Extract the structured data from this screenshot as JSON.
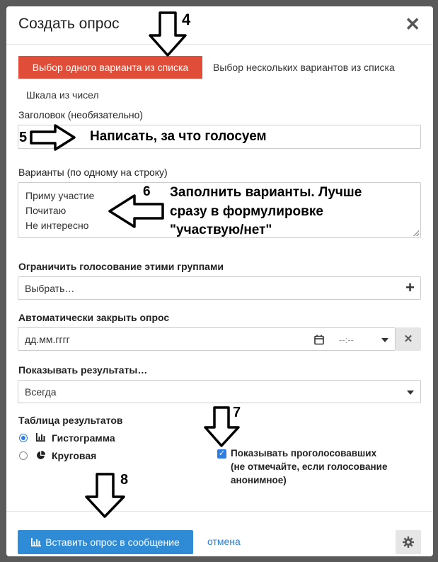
{
  "dialog": {
    "title": "Создать опрос",
    "close_label": "✕"
  },
  "tabs": [
    {
      "label": "Выбор одного варианта из списка",
      "active": true
    },
    {
      "label": "Выбор нескольких вариантов из списка",
      "active": false
    },
    {
      "label": "Шкала из чисел",
      "active": false
    }
  ],
  "question": {
    "label": "Заголовок (необязательно)",
    "value": ""
  },
  "options": {
    "label": "Варианты (по одному на строку)",
    "lines": [
      "Приму участие",
      "Почитаю",
      "Не интересно"
    ]
  },
  "groups": {
    "label": "Ограничить голосование этими группами",
    "placeholder": "Выбрать…",
    "add_label": "+"
  },
  "autoclose": {
    "label": "Автоматически закрыть опрос",
    "date_placeholder": "дд.мм.гггг",
    "time_placeholder": "--:--",
    "clear_label": "✕"
  },
  "results": {
    "label": "Показывать результаты…",
    "selected": "Всегда"
  },
  "chart_type": {
    "label": "Таблица результатов",
    "options": [
      {
        "label": "Гистограмма",
        "checked": true
      },
      {
        "label": "Круговая",
        "checked": false
      }
    ]
  },
  "public_voters": {
    "checked": true,
    "lines": [
      "Показывать проголосовавших",
      "(не отмечайте, если голосование",
      "анонимное)"
    ]
  },
  "footer": {
    "insert_label": "Вставить опрос в сообщение",
    "cancel_label": "отмена"
  },
  "annotations": {
    "n4": "4",
    "n5": "5",
    "n6": "6",
    "n7": "7",
    "n8": "8",
    "title_hint": "Написать, за что голосуем",
    "options_hint": [
      "Заполнить варианты. Лучше",
      "сразу в формулировке",
      "\"участвую/нет\""
    ]
  },
  "colors": {
    "accent_tab": "#e04e39",
    "primary_button": "#2f8bd6",
    "link": "#2a7fd4",
    "checkbox": "#2f7de1"
  }
}
